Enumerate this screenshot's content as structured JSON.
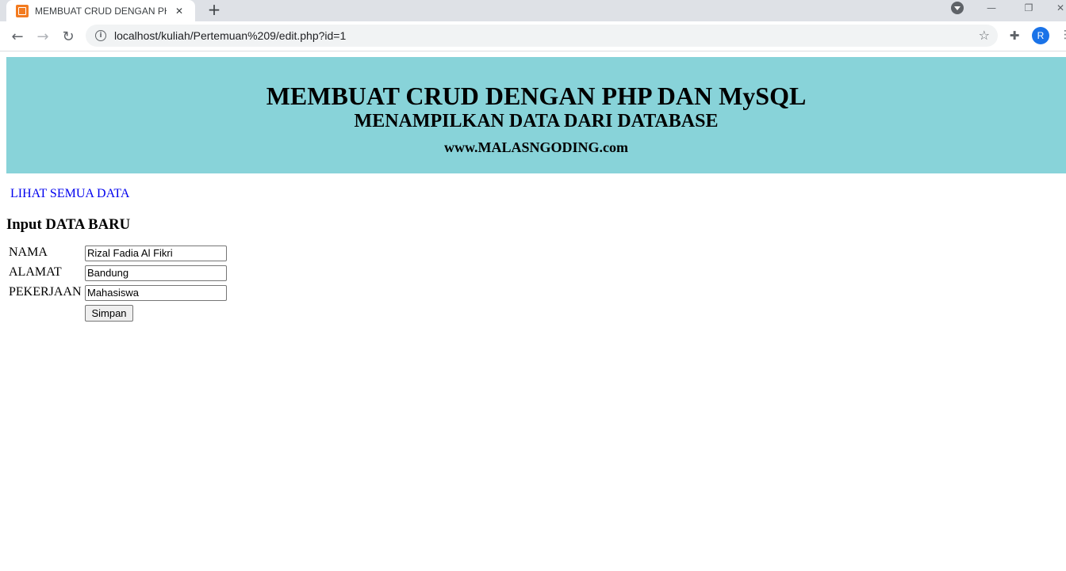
{
  "browser": {
    "tab_title": "MEMBUAT CRUD DENGAN PHP DAN MySQL",
    "tab_close_icon": "close-icon",
    "new_tab_icon": "plus-icon",
    "url": "localhost/kuliah/Pertemuan%209/edit.php?id=1",
    "avatar_letter": "R",
    "colors": {
      "tab_strip": "#dee1e6",
      "omnibox": "#f1f3f4",
      "avatar": "#1a73e8"
    }
  },
  "page": {
    "banner": {
      "title": "MEMBUAT CRUD DENGAN PHP DAN MySQL",
      "subtitle": "MENAMPILKAN DATA DARI DATABASE",
      "site": "www.MALASNGODING.com",
      "background": "#88d3d9"
    },
    "view_all_link": "LIHAT SEMUA DATA",
    "form_title": "Input DATA BARU",
    "form": {
      "nama_label": "NAMA",
      "nama_value": "Rizal Fadia Al Fikri",
      "alamat_label": "ALAMAT",
      "alamat_value": "Bandung",
      "pekerjaan_label": "PEKERJAAN",
      "pekerjaan_value": "Mahasiswa",
      "submit_label": "Simpan"
    }
  }
}
